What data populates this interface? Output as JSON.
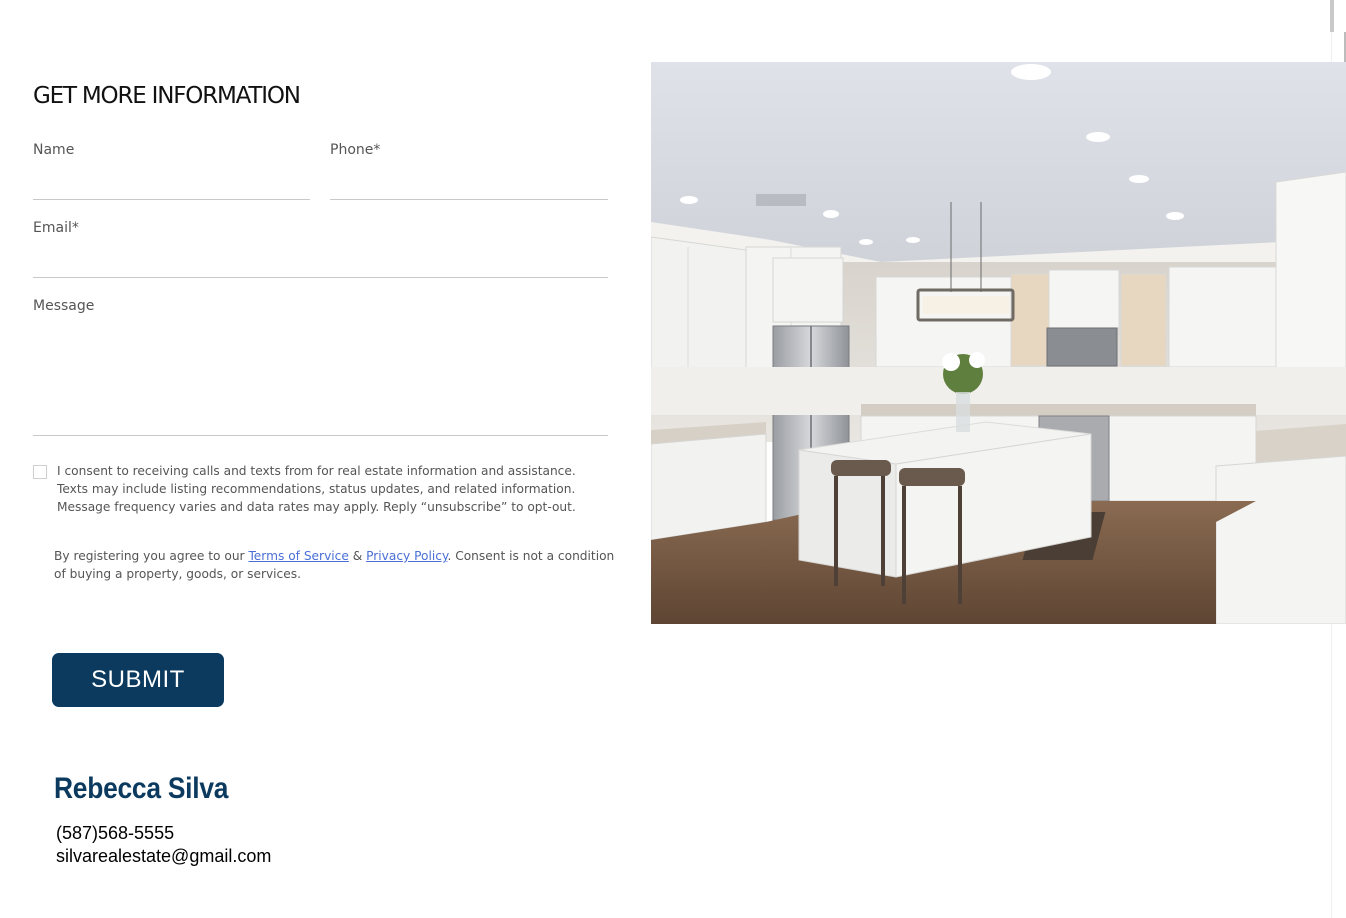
{
  "form": {
    "heading": "GET MORE INFORMATION",
    "name_label": "Name",
    "phone_label": "Phone*",
    "email_label": "Email*",
    "message_label": "Message",
    "consent_text": "I consent to receiving calls and texts from for real estate information and assistance. Texts may include listing recommendations, status updates, and related information. Message frequency varies and data rates may apply. Reply “unsubscribe” to opt-out.",
    "terms_prefix": "By registering you agree to our ",
    "terms_link": "Terms of Service",
    "terms_and": " & ",
    "privacy_link": "Privacy Policy",
    "terms_suffix": ". Consent is not a condition of buying a property, goods, or services.",
    "submit_label": "SUBMIT"
  },
  "agent": {
    "name": "Rebecca Silva",
    "phone": "(587)568-5555",
    "email": "silvarealestate@gmail.com"
  },
  "colors": {
    "brand": "#0b3a5e",
    "link": "#4a6fd6"
  }
}
